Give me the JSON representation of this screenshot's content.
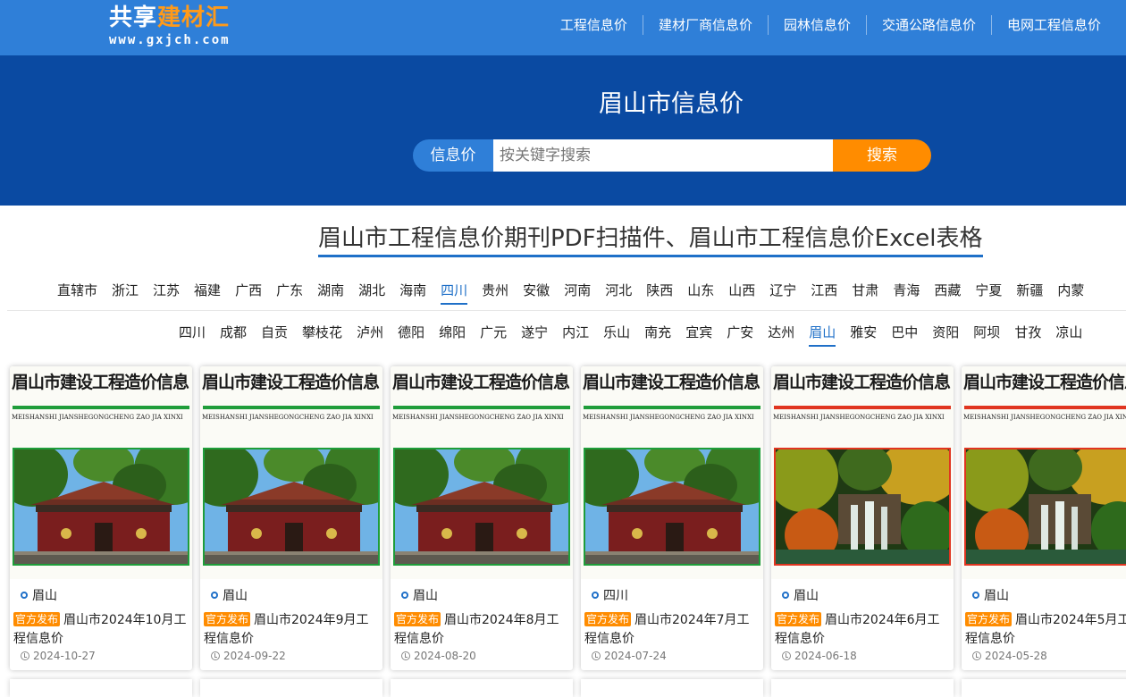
{
  "logo": {
    "name_part1": "共享",
    "name_part2": "建材汇",
    "domain": "www.gxjch.com"
  },
  "nav": [
    "工程信息价",
    "建材厂商信息价",
    "园林信息价",
    "交通公路信息价",
    "电网工程信息价"
  ],
  "hero": {
    "title": "眉山市信息价",
    "search_tag": "信息价",
    "search_placeholder": "按关键字搜索",
    "search_button": "搜索"
  },
  "section_title": "眉山市工程信息价期刊PDF扫描件、眉山市工程信息价Excel表格",
  "provinces": [
    "直辖市",
    "浙江",
    "江苏",
    "福建",
    "广西",
    "广东",
    "湖南",
    "湖北",
    "海南",
    "四川",
    "贵州",
    "安徽",
    "河南",
    "河北",
    "陕西",
    "山东",
    "山西",
    "辽宁",
    "江西",
    "甘肃",
    "青海",
    "西藏",
    "宁夏",
    "新疆",
    "内蒙"
  ],
  "active_province": "四川",
  "cities": [
    "四川",
    "成都",
    "自贡",
    "攀枝花",
    "泸州",
    "德阳",
    "绵阳",
    "广元",
    "遂宁",
    "内江",
    "乐山",
    "南充",
    "宜宾",
    "广安",
    "达州",
    "眉山",
    "雅安",
    "巴中",
    "资阳",
    "阿坝",
    "甘孜",
    "凉山"
  ],
  "active_city": "眉山",
  "cover": {
    "title": "眉山市建设工程造价信息",
    "subtitle": "MEISHANSHI JIANSHEGONGCHENG ZAO JIA XINXI"
  },
  "badge": "官方发布",
  "cards": [
    {
      "city": "眉山",
      "title": "眉山市2024年10月工程信息价",
      "date": "2024-10-27",
      "theme": "green",
      "scene": "temple"
    },
    {
      "city": "眉山",
      "title": "眉山市2024年9月工程信息价",
      "date": "2024-09-22",
      "theme": "green",
      "scene": "temple"
    },
    {
      "city": "眉山",
      "title": "眉山市2024年8月工程信息价",
      "date": "2024-08-20",
      "theme": "green",
      "scene": "temple"
    },
    {
      "city": "四川",
      "title": "眉山市2024年7月工程信息价",
      "date": "2024-07-24",
      "theme": "green",
      "scene": "temple"
    },
    {
      "city": "眉山",
      "title": "眉山市2024年6月工程信息价",
      "date": "2024-06-18",
      "theme": "red",
      "scene": "waterfall"
    },
    {
      "city": "眉山",
      "title": "眉山市2024年5月工程信息价",
      "date": "2024-05-28",
      "theme": "red",
      "scene": "waterfall"
    }
  ],
  "colors": {
    "topbar": "#2f7fd8",
    "hero": "#0a4aa2",
    "accent": "#ff8c00",
    "link": "#1f70c8"
  }
}
